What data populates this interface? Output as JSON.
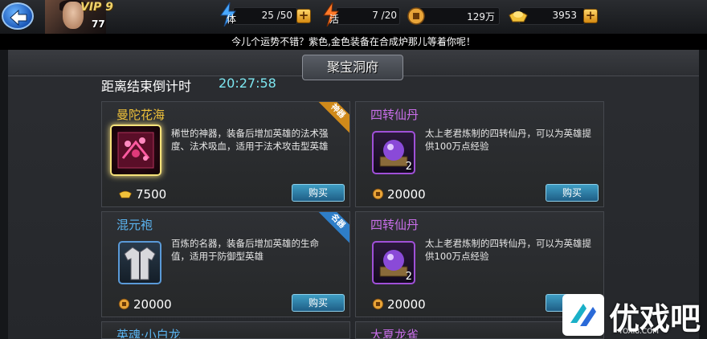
{
  "header": {
    "vip_label": "VIP 9",
    "player_level": "77",
    "stamina": {
      "icon_text": "体",
      "value": "25 /50"
    },
    "vitality": {
      "icon_text": "活",
      "value": "7 /20"
    },
    "copper": {
      "value": "129万"
    },
    "gold": {
      "value": "3953"
    },
    "plus_symbol": "+"
  },
  "marquee": {
    "text": "今儿个运势不错？紫色,金色装备在合成炉那儿等着你呢！"
  },
  "shop": {
    "title": "聚宝洞府",
    "countdown_label": "距离结束倒计时",
    "countdown_value": "20:27:58",
    "buy_label": "购买",
    "items": [
      {
        "name": "曼陀花海",
        "name_color": "#f0c23a",
        "description": "稀世的神器，装备后增加英雄的法术强度、法术吸血，适用于法术攻击型英雄",
        "price": "7500",
        "currency": "gold-ingot-icon",
        "ribbon": "神器",
        "ribbon_color": "#d08a1a"
      },
      {
        "name": "四转仙丹",
        "name_color": "#c86ee8",
        "description": "太上老君炼制的四转仙丹，可以为英雄提供100万点经验",
        "price": "20000",
        "currency": "copper-coin-icon",
        "quantity": "2"
      },
      {
        "name": "混元袍",
        "name_color": "#5bb4f0",
        "description": "百炼的名器，装备后增加英雄的生命值，适用于防御型英雄",
        "price": "20000",
        "currency": "copper-coin-icon",
        "ribbon": "名器",
        "ribbon_color": "#2e7ec8"
      },
      {
        "name": "四转仙丹",
        "name_color": "#c86ee8",
        "description": "太上老君炼制的四转仙丹，可以为英雄提供100万点经验",
        "price": "20000",
        "currency": "copper-coin-icon",
        "quantity": "2"
      },
      {
        "name": "英魂·小白龙",
        "name_color": "#5bb4f0"
      },
      {
        "name": "大夏龙雀",
        "name_color": "#c86ee8"
      }
    ]
  },
  "watermark": {
    "text": "优戏吧",
    "url": "YOXI8.COM"
  }
}
